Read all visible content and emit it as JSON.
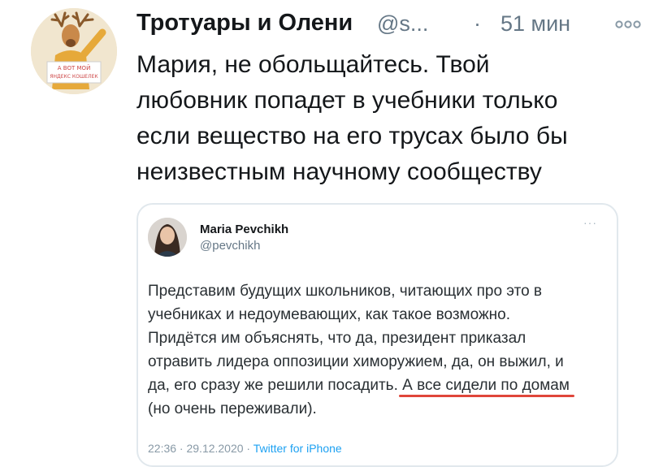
{
  "tweet": {
    "display_name": "Тротуары и Олени",
    "handle": "@s...",
    "separator": "·",
    "time": "51 мин",
    "lines": [
      "Мария, не обольщайтесь. Твой",
      "любовник попадет в учебники только",
      "если вещество на его трусах было бы",
      "неизвестным научному сообществу"
    ],
    "avatar_caption": [
      "А ВОТ МОЙ",
      "ЯНДЕКС КОШЕЛЕК"
    ]
  },
  "quoted": {
    "name": "Maria Pevchikh",
    "handle": "@pevchikh",
    "more": "···",
    "lines": [
      "Представим будущих школьников, читающих про это в",
      "учебниках и недоумевающих, как такое возможно.",
      "Придётся им объяснять, что да, президент приказал",
      "отравить лидера оппозиции химоружием, да, он выжил, и"
    ],
    "line5_prefix": "да, его сразу же решили посадить. ",
    "line5_underlined": "А все сидели по домам",
    "line6": "(но очень переживали).",
    "timestamp": "22:36 · 29.12.2020 · ",
    "source": "Twitter for iPhone"
  },
  "colors": {
    "accent": "#1da1f2",
    "underline": "#e0463a",
    "muted": "#657786"
  },
  "icons": {
    "more": "more-options-icon"
  }
}
